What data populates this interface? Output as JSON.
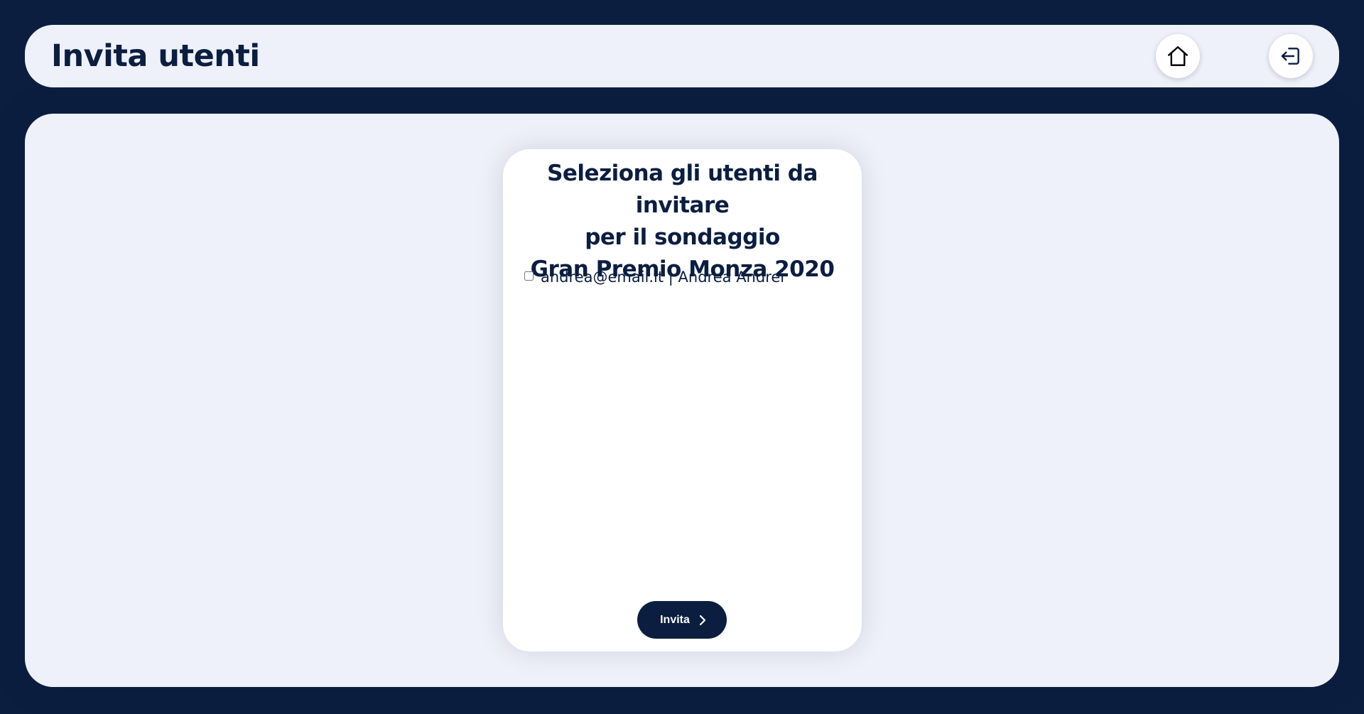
{
  "header": {
    "title": "Invita utenti",
    "home_icon": "home-icon",
    "logout_icon": "logout-icon"
  },
  "card": {
    "title_line1": "Seleziona gli utenti da invitare",
    "title_line2": "per il sondaggio",
    "title_line3": "Gran Premio Monza 2020",
    "users": [
      {
        "label": "andrea@email.it | Andrea Andrei",
        "checked": false
      }
    ],
    "invite_button_label": "Invita",
    "invite_button_icon": "chevron-right-icon"
  },
  "colors": {
    "background": "#0b1e40",
    "panel": "#eef1fa",
    "card": "#ffffff",
    "accent": "#0b1e40"
  }
}
